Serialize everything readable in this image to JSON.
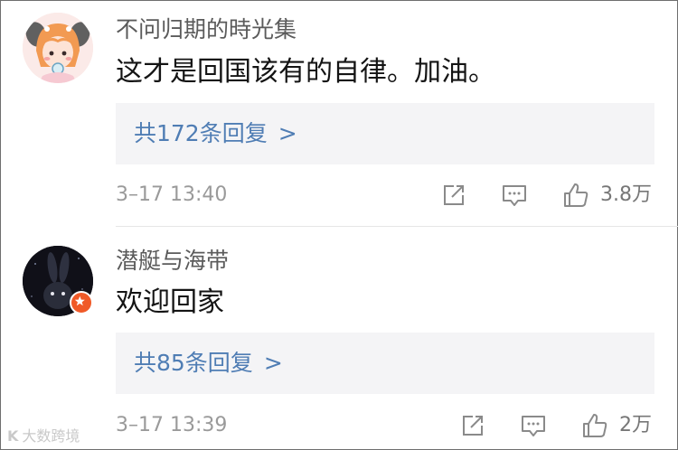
{
  "comments": [
    {
      "username": "不问归期的時光集",
      "text": "这才是回国该有的自律。加油。",
      "replies_label": "共172条回复",
      "chevron": ">",
      "time": "3–17 13:40",
      "like_count": "3.8万",
      "avatar_icon": "cartoon-girl-avatar"
    },
    {
      "username": "潜艇与海带",
      "text": "欢迎回家",
      "replies_label": "共85条回复",
      "chevron": ">",
      "time": "3–17 13:39",
      "like_count": "2万",
      "avatar_icon": "rabbit-silhouette-avatar",
      "badge_icon": "verified-star-badge"
    }
  ],
  "watermark": {
    "logo": "K",
    "text": "大数跨境"
  },
  "colors": {
    "link": "#4f7db4",
    "username": "#5b5b5b",
    "body_text": "#141414",
    "meta_text": "#9a9a9a",
    "reply_bg": "#f4f4f6",
    "badge": "#f05a28"
  }
}
